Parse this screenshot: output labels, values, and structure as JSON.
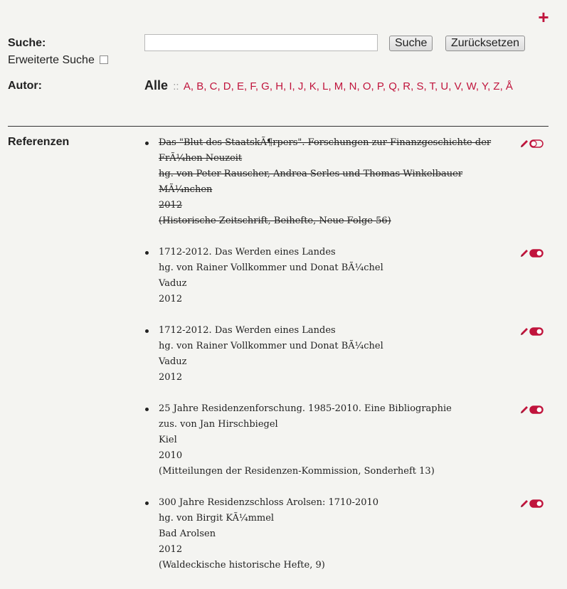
{
  "header": {
    "add_icon_glyph": "+",
    "search_label": "Suche:",
    "search_value": "",
    "search_button": "Suche",
    "reset_button": "Zurücksetzen",
    "advanced_label": "Erweiterte Suche",
    "author_label": "Autor:",
    "alpha_all": "Alle",
    "alpha_separator": "::",
    "letters": [
      "A",
      "B",
      "C",
      "D",
      "E",
      "F",
      "G",
      "H",
      "I",
      "J",
      "K",
      "L",
      "M",
      "N",
      "O",
      "P",
      "Q",
      "R",
      "S",
      "T",
      "U",
      "V",
      "W",
      "Y",
      "Z",
      "Å"
    ]
  },
  "references_label": "Referenzen",
  "colors": {
    "accent": "#c0143c",
    "background": "#f4f4f1"
  },
  "references": [
    {
      "struck": true,
      "toggle_state": "off",
      "lines": [
        "Das \"Blut des StaatskÃ¶rpers\". Forschungen zur Finanzgeschichte der",
        "FrÃ¼hen Neuzeit",
        "hg. von Peter Rauscher, Andrea Serles und Thomas Winkelbauer",
        "MÃ¼nchen",
        "2012",
        "(Historische Zeitschrift, Beihefte, Neue Folge 56)"
      ]
    },
    {
      "struck": false,
      "toggle_state": "on",
      "lines": [
        "1712-2012. Das Werden eines Landes",
        "hg. von Rainer Vollkommer und Donat BÃ¼chel",
        "Vaduz",
        "2012"
      ]
    },
    {
      "struck": false,
      "toggle_state": "on",
      "lines": [
        "1712-2012. Das Werden eines Landes",
        "hg. von Rainer Vollkommer und Donat BÃ¼chel",
        "Vaduz",
        "2012"
      ]
    },
    {
      "struck": false,
      "toggle_state": "on",
      "lines": [
        "25 Jahre Residenzenforschung. 1985-2010. Eine Bibliographie",
        "zus. von Jan Hirschbiegel",
        "Kiel",
        "2010",
        "(Mitteilungen der Residenzen-Kommission, Sonderheft 13)"
      ]
    },
    {
      "struck": false,
      "toggle_state": "on",
      "lines": [
        "300 Jahre Residenzschloss Arolsen: 1710-2010",
        "hg. von Birgit KÃ¼mmel",
        "Bad Arolsen",
        "2012",
        "(Waldeckische historische Hefte, 9)"
      ]
    }
  ]
}
